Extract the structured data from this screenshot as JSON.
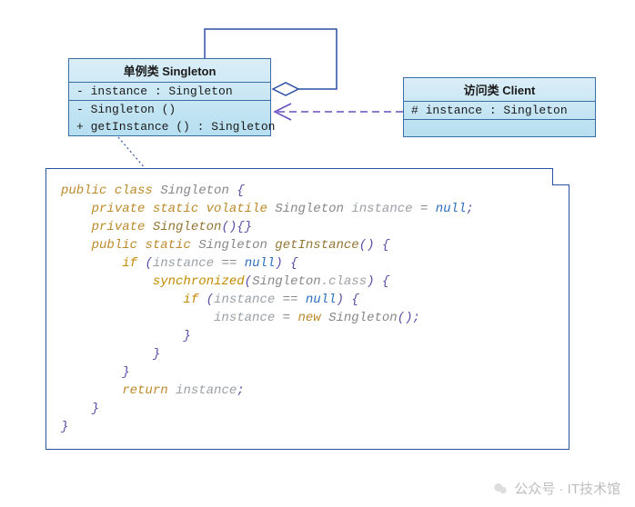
{
  "uml": {
    "singleton": {
      "title": "单例类 Singleton",
      "attr1": "- instance : Singleton",
      "op1": "- Singleton ()",
      "op2": "+ getInstance () : Singleton"
    },
    "client": {
      "title": "访问类 Client",
      "attr1": "# instance : Singleton"
    }
  },
  "relations": {
    "self_aggregation": {
      "from": "Singleton",
      "to": "Singleton",
      "kind": "aggregation"
    },
    "dependency": {
      "from": "Client",
      "to": "Singleton",
      "kind": "dependency"
    },
    "note_link": {
      "from": "code-note",
      "to": "Singleton",
      "kind": "anchor"
    }
  },
  "code": {
    "line1_kw_public": "public",
    "line1_kw_class": "class",
    "line1_type": "Singleton",
    "line1_brace": "{",
    "line2_kw1": "private",
    "line2_kw2": "static",
    "line2_kw3": "volatile",
    "line2_type": "Singleton",
    "line2_var": "instance",
    "line2_eq": "=",
    "line2_null": "null",
    "line2_semi": ";",
    "line3_kw": "private",
    "line3_name": "Singleton",
    "line3_rest": "(){}",
    "line4_kw1": "public",
    "line4_kw2": "static",
    "line4_type": "Singleton",
    "line4_name": "getInstance",
    "line4_par": "()",
    "line4_brace": "{",
    "line5_if": "if",
    "line5_lpar": "(",
    "line5_var": "instance",
    "line5_eqeq": "==",
    "line5_null": "null",
    "line5_rpar": ")",
    "line5_brace": "{",
    "line6_sync": "synchronized",
    "line6_lpar": "(",
    "line6_type": "Singleton",
    "line6_dotclass": ".class",
    "line6_rpar": ")",
    "line6_brace": "{",
    "line7_if": "if",
    "line7_lpar": "(",
    "line7_var": "instance",
    "line7_eqeq": "==",
    "line7_null": "null",
    "line7_rpar": ")",
    "line7_brace": "{",
    "line8_var": "instance",
    "line8_eq": "=",
    "line8_new": "new",
    "line8_type": "Singleton",
    "line8_call": "();",
    "line9": "}",
    "line10": "}",
    "line11": "}",
    "line12_ret": "return",
    "line12_var": "instance",
    "line12_semi": ";",
    "line13": "}",
    "line14": "}"
  },
  "watermark": "公众号 · IT技术馆"
}
